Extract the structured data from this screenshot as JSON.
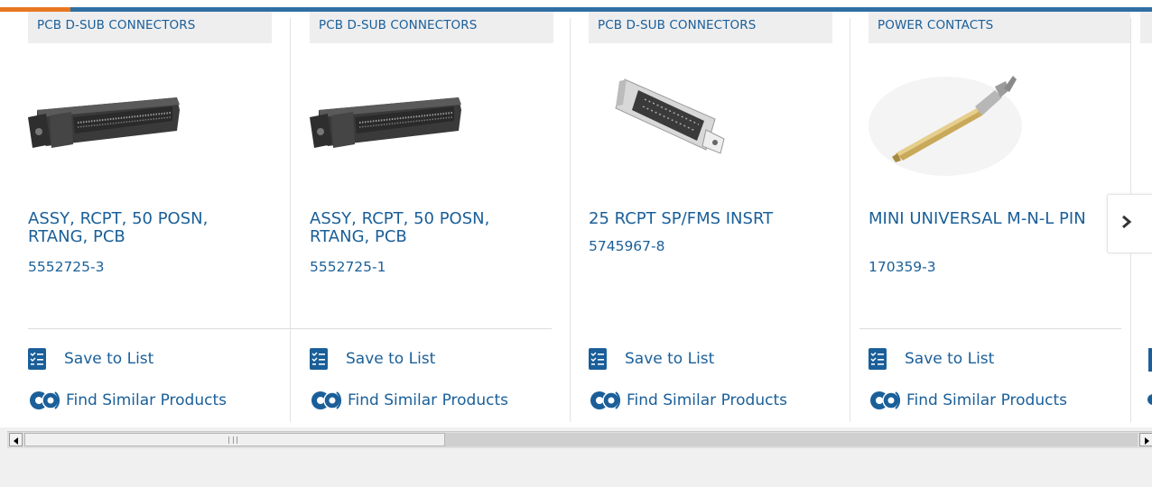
{
  "colors": {
    "brand_blue": "#1a5f99",
    "accent_orange": "#e87722",
    "topbar_blue": "#2f6fa3",
    "category_bg": "#eeeeef"
  },
  "products": [
    {
      "category": "PCB D-SUB CONNECTORS",
      "title": "ASSY, RCPT, 50 POSN, RTANG, PCB",
      "part_number": "5552725-3",
      "image": "right-angle-50-pos-connector",
      "save_label": "Save to List",
      "find_label": "Find Similar Products"
    },
    {
      "category": "PCB D-SUB CONNECTORS",
      "title": "ASSY, RCPT, 50 POSN, RTANG, PCB",
      "part_number": "5552725-1",
      "image": "right-angle-50-pos-connector",
      "save_label": "Save to List",
      "find_label": "Find Similar Products"
    },
    {
      "category": "PCB D-SUB CONNECTORS",
      "title": "25 RCPT SP/FMS INSRT",
      "part_number": "5745967-8",
      "image": "d-sub-25-receptacle",
      "save_label": "Save to List",
      "find_label": "Find Similar Products"
    },
    {
      "category": "POWER CONTACTS",
      "title": "MINI UNIVERSAL M-N-L PIN",
      "part_number": "170359-3",
      "image": "crimp-pin-contact",
      "save_label": "Save to List",
      "find_label": "Find Similar Products"
    }
  ],
  "carousel": {
    "next_icon": "chevron-right-icon"
  },
  "scrollbar": {
    "left_icon": "triangle-left-icon",
    "right_icon": "triangle-right-icon"
  }
}
